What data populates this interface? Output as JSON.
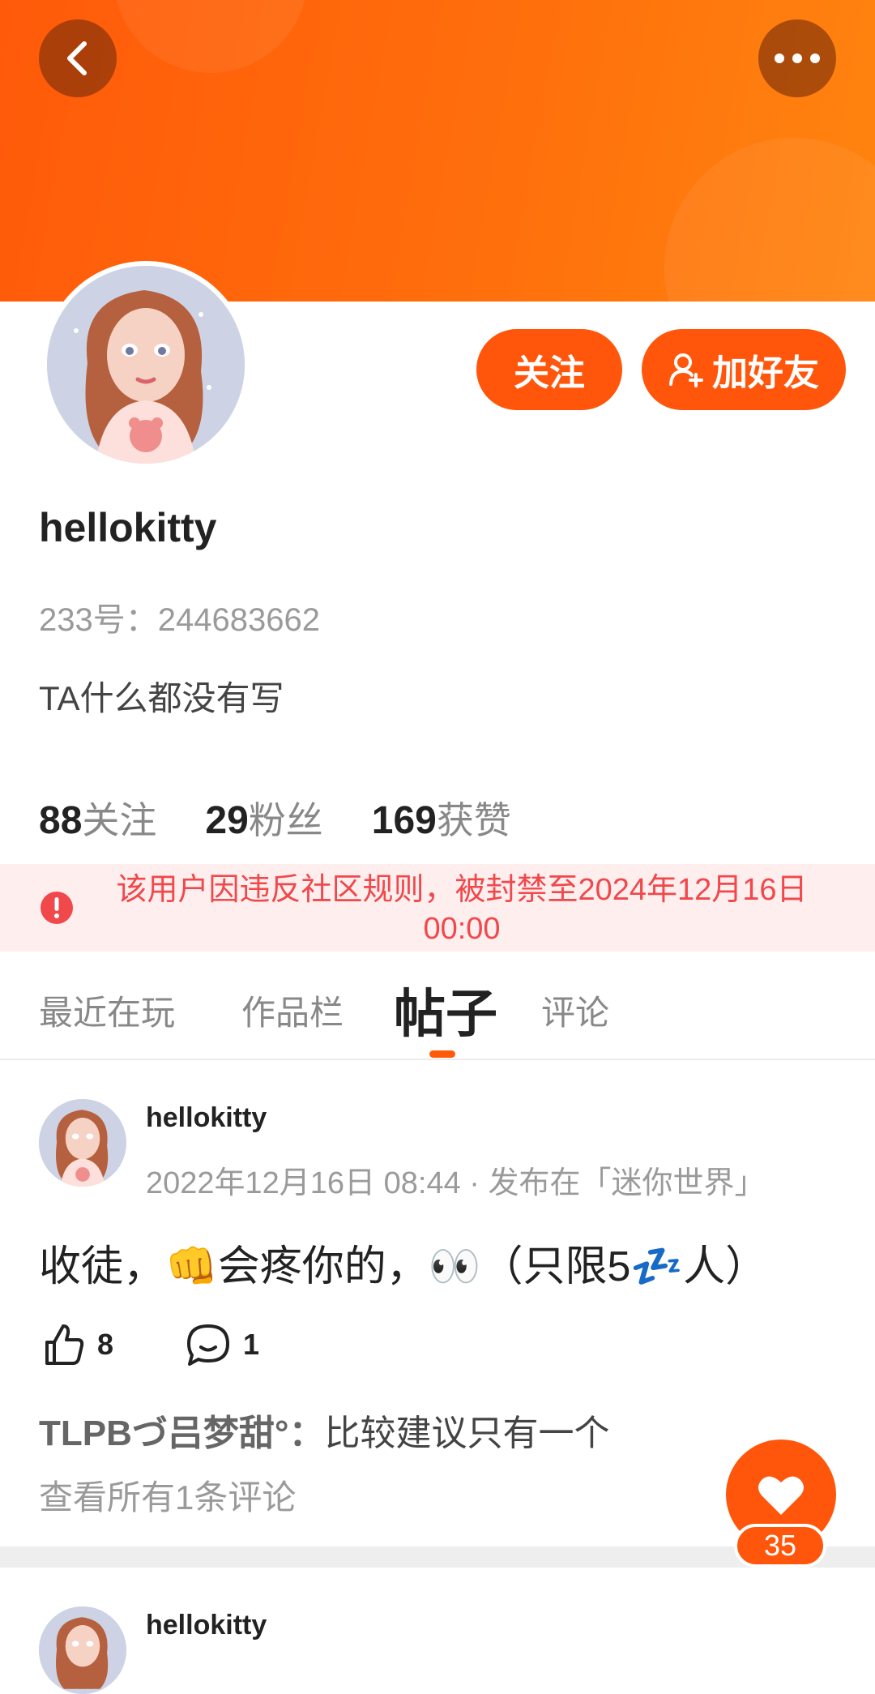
{
  "profile": {
    "username": "hellokitty",
    "id_label": "233号：",
    "id_value": "244683662",
    "bio": "TA什么都没有写"
  },
  "actions": {
    "follow_label": "关注",
    "add_friend_label": "加好友"
  },
  "stats": [
    {
      "value": "88",
      "label": "关注"
    },
    {
      "value": "29",
      "label": "粉丝"
    },
    {
      "value": "169",
      "label": "获赞"
    }
  ],
  "ban_notice": {
    "text": "该用户因违反社区规则，被封禁至2024年12月16日 00:00"
  },
  "tabs": [
    {
      "label": "最近在玩",
      "active": false
    },
    {
      "label": "作品栏",
      "active": false
    },
    {
      "label": "帖子",
      "active": true
    },
    {
      "label": "评论",
      "active": false
    }
  ],
  "posts": [
    {
      "author": "hellokitty",
      "meta": "2022年12月16日 08:44 · 发布在「迷你世界」",
      "content": "收徒，👊会疼你的，👀（只限5💤人）",
      "likes": "8",
      "comments": "1",
      "top_comment_author": "TLPBづ吕梦甜°：",
      "top_comment_text": "比较建议只有一个",
      "view_all": "查看所有1条评论"
    },
    {
      "author": "hellokitty"
    }
  ],
  "fab": {
    "count": "35"
  },
  "colors": {
    "accent": "#ff560b",
    "ban_bg": "#ffeeee",
    "ban_text": "#f0484b"
  }
}
